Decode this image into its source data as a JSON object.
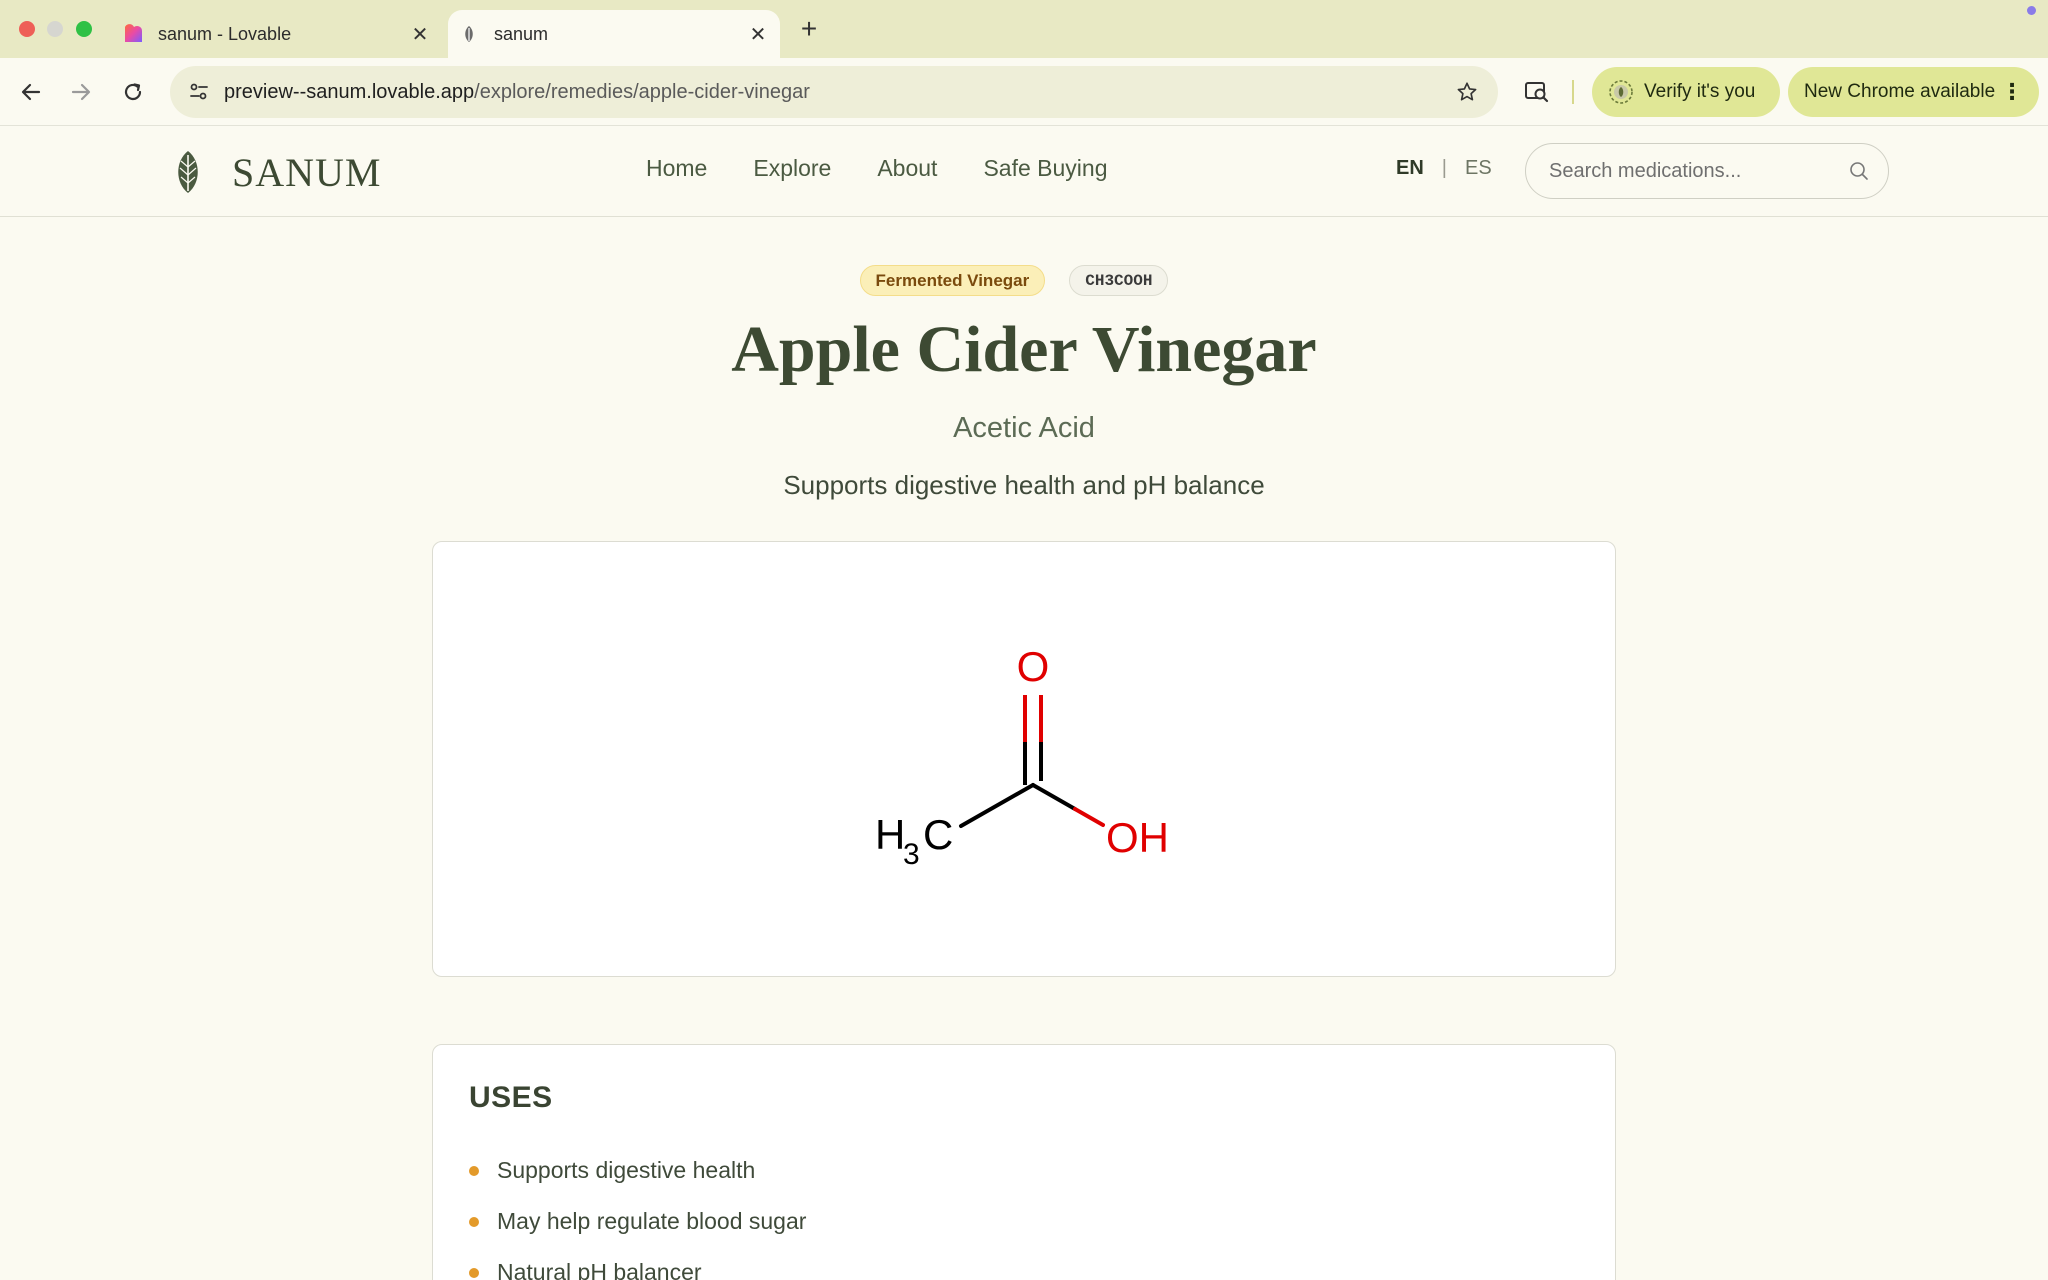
{
  "browser": {
    "tabs": [
      {
        "title": "sanum - Lovable",
        "active": false
      },
      {
        "title": "sanum",
        "active": true
      }
    ],
    "url_host": "preview--sanum.lovable.app",
    "url_path": "/explore/remedies/apple-cider-vinegar",
    "verify_label": "Verify it's you",
    "update_label": "New Chrome available",
    "kebab": "⋮",
    "new_tab": "+",
    "close": "✕"
  },
  "header": {
    "brand": "SANUM",
    "nav": [
      "Home",
      "Explore",
      "About",
      "Safe Buying"
    ],
    "lang_active": "EN",
    "lang_other": "ES",
    "lang_separator": "|",
    "search_placeholder": "Search medications..."
  },
  "remedy": {
    "category_tag": "Fermented Vinegar",
    "formula_tag": "CH3COOH",
    "name": "Apple Cider Vinegar",
    "compound": "Acetic Acid",
    "tagline": "Supports digestive health and pH balance"
  },
  "structure": {
    "methyl_h": "H",
    "methyl_sub": "3",
    "methyl_c": "C",
    "carbonyl_o": "O",
    "hydroxyl": "OH",
    "bond_color": "#000000",
    "hetero_color": "#e00000"
  },
  "uses": {
    "title": "USES",
    "items": [
      "Supports digestive health",
      "May help regulate blood sugar",
      "Natural pH balancer"
    ]
  },
  "colors": {
    "accent_olive": "#3d4a33",
    "pill_lime": "#e0e796",
    "tag_amber": "#fbefb8",
    "bullet_orange": "#e39a2a"
  }
}
